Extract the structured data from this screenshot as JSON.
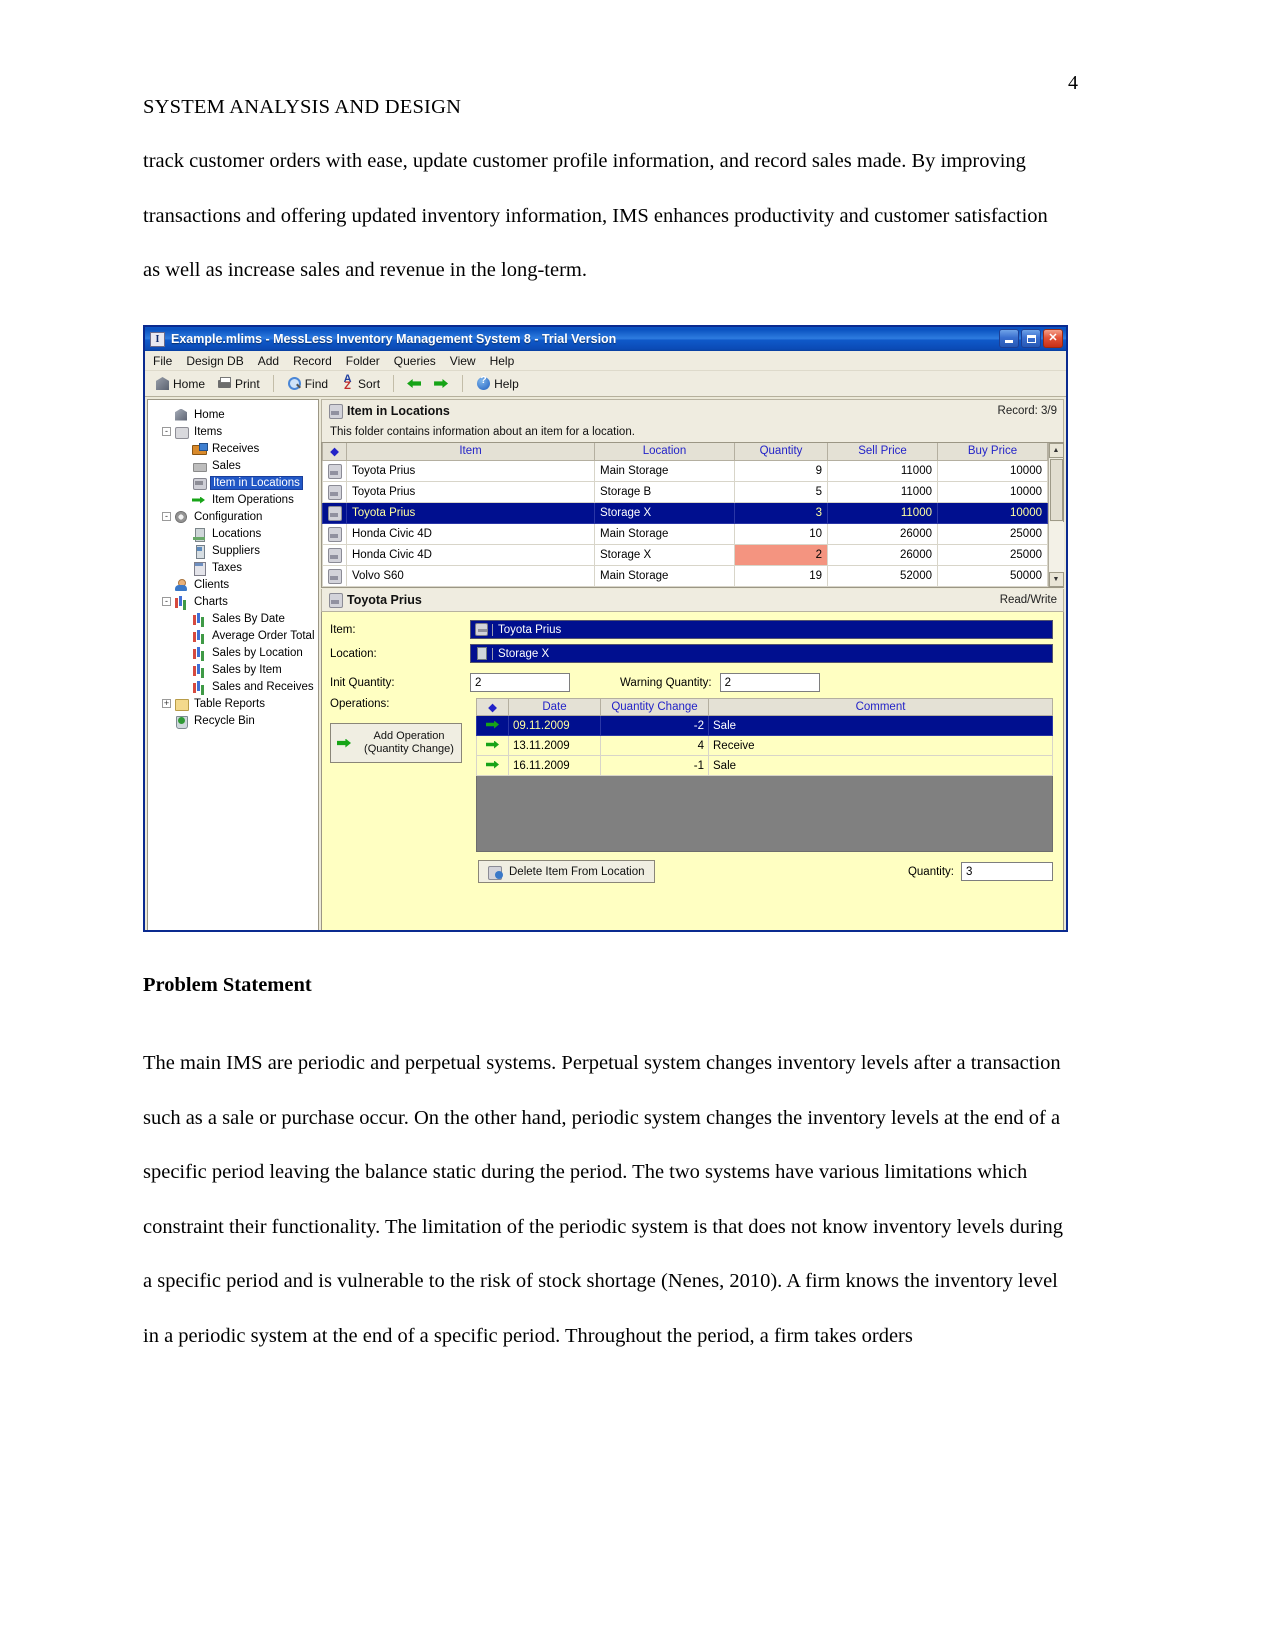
{
  "document": {
    "page_number": "4",
    "running_head": "SYSTEM ANALYSIS AND DESIGN",
    "paragraph_1": "track customer orders with ease, update customer profile information, and record sales made. By improving transactions and offering updated inventory information, IMS enhances productivity and customer satisfaction as well as increase sales and revenue in the long-term.",
    "heading_problem_statement": "Problem Statement",
    "paragraph_2": "The main IMS are periodic and perpetual systems. Perpetual system changes inventory levels after a transaction such as a sale or purchase occur. On the other hand, periodic system changes the inventory levels at the end of a specific period leaving the balance static during the period. The two systems have various limitations which constraint their functionality. The limitation of the periodic system is that does not know inventory levels during a specific period and is vulnerable to the risk of stock shortage (Nenes, 2010). A firm knows the inventory level in a periodic system at the end of a specific period. Throughout the period, a firm takes orders"
  },
  "app": {
    "title": "Example.mlims - MessLess Inventory Management System 8 - Trial Version",
    "title_icon": "I",
    "window_buttons": {
      "minimize": "minimize-icon",
      "maximize": "maximize-icon",
      "close": "✕"
    },
    "menu": [
      "File",
      "Design DB",
      "Add",
      "Record",
      "Folder",
      "Queries",
      "View",
      "Help"
    ],
    "toolbar": [
      {
        "label": "Home",
        "icon": "home-icon"
      },
      {
        "label": "Print",
        "icon": "printer-icon"
      },
      {
        "label": "Find",
        "icon": "magnifier-icon"
      },
      {
        "label": "Sort",
        "icon": "sort-az-icon"
      },
      {
        "label": "",
        "icon": "arrow-left-icon"
      },
      {
        "label": "",
        "icon": "arrow-right-icon"
      },
      {
        "label": "Help",
        "icon": "help-icon"
      }
    ],
    "tree": [
      {
        "label": "Home",
        "level": 1,
        "icon": "home-icon",
        "expander": "",
        "selected": false
      },
      {
        "label": "Items",
        "level": 1,
        "icon": "items-icon",
        "expander": "-",
        "selected": false
      },
      {
        "label": "Receives",
        "level": 2,
        "icon": "receives-icon",
        "expander": "",
        "selected": false
      },
      {
        "label": "Sales",
        "level": 2,
        "icon": "sales-icon",
        "expander": "",
        "selected": false
      },
      {
        "label": "Item in Locations",
        "level": 2,
        "icon": "box-icon",
        "expander": "",
        "selected": true
      },
      {
        "label": "Item Operations",
        "level": 2,
        "icon": "arrow-icon",
        "expander": "",
        "selected": false
      },
      {
        "label": "Configuration",
        "level": 1,
        "icon": "gear-icon",
        "expander": "-",
        "selected": false
      },
      {
        "label": "Locations",
        "level": 2,
        "icon": "location-icon",
        "expander": "",
        "selected": false
      },
      {
        "label": "Suppliers",
        "level": 2,
        "icon": "supplier-icon",
        "expander": "",
        "selected": false
      },
      {
        "label": "Taxes",
        "level": 2,
        "icon": "taxes-icon",
        "expander": "",
        "selected": false
      },
      {
        "label": "Clients",
        "level": 1,
        "icon": "client-icon",
        "expander": "",
        "selected": false
      },
      {
        "label": "Charts",
        "level": 1,
        "icon": "chart-icon",
        "expander": "-",
        "selected": false
      },
      {
        "label": "Sales By Date",
        "level": 2,
        "icon": "chart-icon",
        "expander": "",
        "selected": false
      },
      {
        "label": "Average Order Total",
        "level": 2,
        "icon": "chart-icon",
        "expander": "",
        "selected": false
      },
      {
        "label": "Sales by Location",
        "level": 2,
        "icon": "chart-icon",
        "expander": "",
        "selected": false
      },
      {
        "label": "Sales by Item",
        "level": 2,
        "icon": "chart-icon",
        "expander": "",
        "selected": false
      },
      {
        "label": "Sales and Receives",
        "level": 2,
        "icon": "chart-icon",
        "expander": "",
        "selected": false
      },
      {
        "label": "Table Reports",
        "level": 1,
        "icon": "report-icon",
        "expander": "+",
        "selected": false
      },
      {
        "label": "Recycle Bin",
        "level": 1,
        "icon": "recycle-icon",
        "expander": "",
        "selected": false
      }
    ],
    "folder": {
      "title": "Item in Locations",
      "record_status": "Record: 3/9",
      "description": "This folder contains information about an item for a location.",
      "columns": [
        "",
        "Item",
        "Location",
        "Quantity",
        "Sell Price",
        "Buy Price"
      ],
      "rows": [
        {
          "item": "Toyota Prius",
          "location": "Main Storage",
          "quantity": "9",
          "sell": "11000",
          "buy": "10000",
          "selected": false,
          "warn": false
        },
        {
          "item": "Toyota Prius",
          "location": "Storage B",
          "quantity": "5",
          "sell": "11000",
          "buy": "10000",
          "selected": false,
          "warn": false
        },
        {
          "item": "Toyota Prius",
          "location": "Storage X",
          "quantity": "3",
          "sell": "11000",
          "buy": "10000",
          "selected": true,
          "warn": false
        },
        {
          "item": "Honda Civic 4D",
          "location": "Main Storage",
          "quantity": "10",
          "sell": "26000",
          "buy": "25000",
          "selected": false,
          "warn": false
        },
        {
          "item": "Honda Civic 4D",
          "location": "Storage X",
          "quantity": "2",
          "sell": "26000",
          "buy": "25000",
          "selected": false,
          "warn": true
        },
        {
          "item": "Volvo S60",
          "location": "Main Storage",
          "quantity": "19",
          "sell": "52000",
          "buy": "50000",
          "selected": false,
          "warn": false
        }
      ]
    },
    "detail": {
      "title": "Toyota Prius",
      "state": "Read/Write",
      "item_label": "Item:",
      "item_value": "Toyota Prius",
      "location_label": "Location:",
      "location_value": "Storage X",
      "init_quantity_label": "Init Quantity:",
      "init_quantity_value": "2",
      "warning_quantity_label": "Warning Quantity:",
      "warning_quantity_value": "2",
      "operations_label": "Operations:",
      "add_operation_line1": "Add Operation",
      "add_operation_line2": "(Quantity Change)",
      "operations_columns": [
        "",
        "Date",
        "Quantity Change",
        "Comment"
      ],
      "operations": [
        {
          "date": "09.11.2009",
          "change": "-2",
          "comment": "Sale",
          "selected": true
        },
        {
          "date": "13.11.2009",
          "change": "4",
          "comment": "Receive",
          "selected": false
        },
        {
          "date": "16.11.2009",
          "change": "-1",
          "comment": "Sale",
          "selected": false
        }
      ],
      "delete_button": "Delete Item From Location",
      "quantity_label": "Quantity:",
      "quantity_value": "3"
    },
    "colors": {
      "title_bar": "#0a52c0",
      "selection": "#000f8f",
      "warning_cell": "#f49480",
      "detail_background": "#ffffc2",
      "header_text": "#2323c8"
    }
  }
}
